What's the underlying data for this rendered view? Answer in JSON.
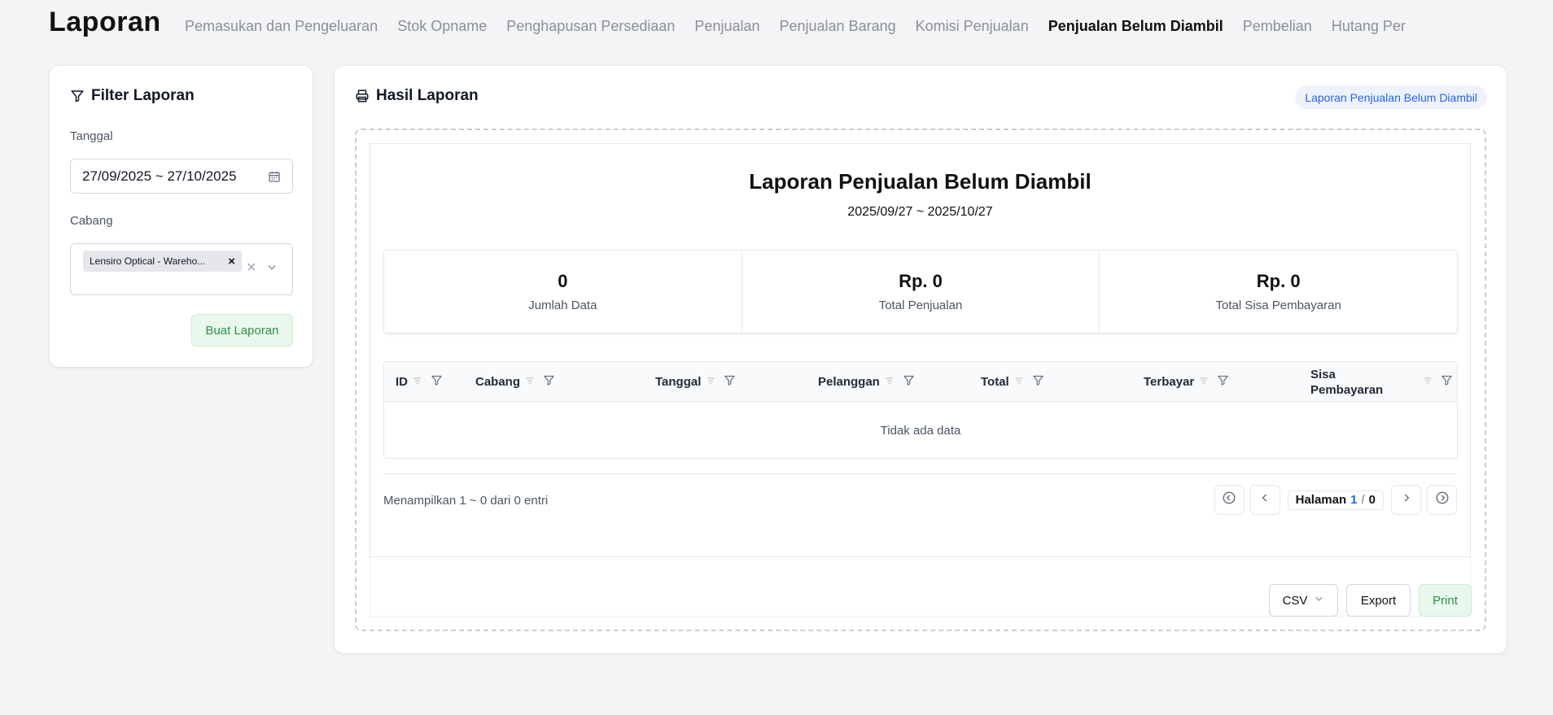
{
  "page": {
    "title": "Laporan"
  },
  "tabs": [
    {
      "label": "Pemasukan dan Pengeluaran",
      "active": false
    },
    {
      "label": "Stok Opname",
      "active": false
    },
    {
      "label": "Penghapusan Persediaan",
      "active": false
    },
    {
      "label": "Penjualan",
      "active": false
    },
    {
      "label": "Penjualan Barang",
      "active": false
    },
    {
      "label": "Komisi Penjualan",
      "active": false
    },
    {
      "label": "Penjualan Belum Diambil",
      "active": true
    },
    {
      "label": "Pembelian",
      "active": false
    },
    {
      "label": "Hutang Pembelian",
      "active": false
    }
  ],
  "filter": {
    "title": "Filter Laporan",
    "date_label": "Tanggal",
    "date_value": "27/09/2025 ~ 27/10/2025",
    "branch_label": "Cabang",
    "branch_chip": "Lensiro Optical - Wareho...",
    "submit_label": "Buat Laporan"
  },
  "result": {
    "title": "Hasil Laporan",
    "badge": "Laporan Penjualan Belum Diambil",
    "report_title": "Laporan Penjualan Belum Diambil",
    "report_range": "2025/09/27 ~ 2025/10/27",
    "stats": [
      {
        "value": "0",
        "label": "Jumlah Data"
      },
      {
        "value": "Rp. 0",
        "label": "Total Penjualan"
      },
      {
        "value": "Rp. 0",
        "label": "Total Sisa Pembayaran"
      }
    ],
    "columns": [
      "ID",
      "Cabang",
      "Tanggal",
      "Pelanggan",
      "Total",
      "Terbayar",
      "Sisa Pembayaran"
    ],
    "empty_text": "Tidak ada data",
    "entries_text": "Menampilkan 1 ~ 0 dari 0 entri",
    "pagination": {
      "label": "Halaman",
      "current": "1",
      "separator": "/",
      "total": "0"
    },
    "export_format": "CSV",
    "export_label": "Export",
    "print_label": "Print"
  }
}
